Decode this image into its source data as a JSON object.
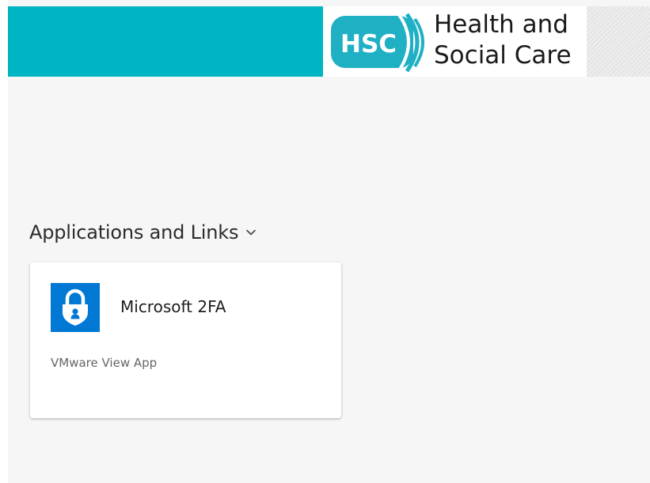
{
  "header": {
    "brand_short": "HSC",
    "brand_line1": "Health and",
    "brand_line2": "Social Care",
    "band_color": "#00b5c3",
    "logo_color": "#1fb0c4"
  },
  "section": {
    "title": "Applications and Links",
    "chevron_icon": "chevron-down-icon"
  },
  "apps": [
    {
      "name": "Microsoft 2FA",
      "type": "VMware View App",
      "icon": "lock-icon",
      "icon_color": "#0078d4"
    }
  ]
}
